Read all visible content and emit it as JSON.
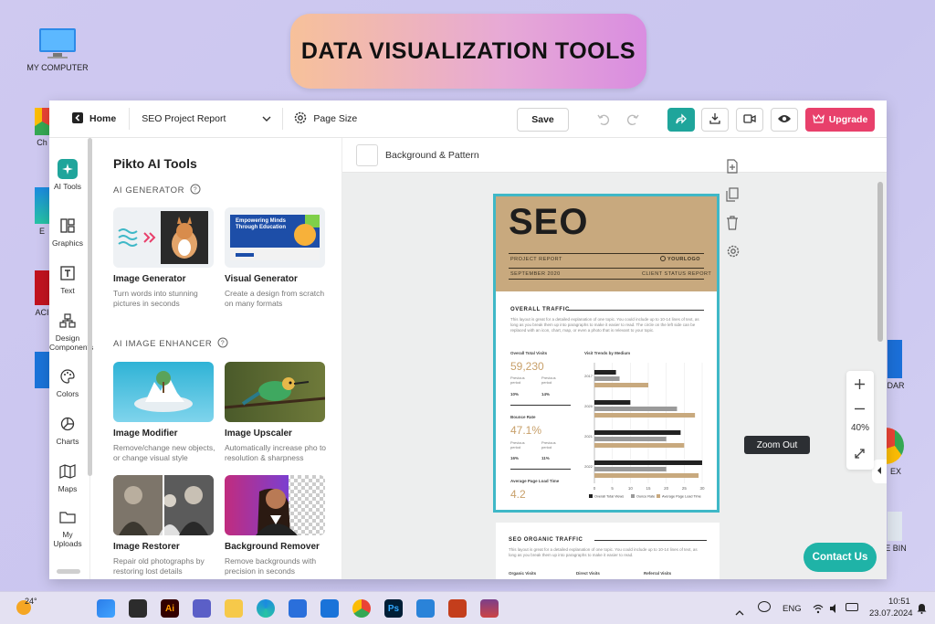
{
  "banner": {
    "title": "DATA VISUALIZATION TOOLS"
  },
  "desktop": {
    "icons": [
      {
        "label": "MY COMPUTER"
      },
      {
        "label": "Ch"
      },
      {
        "label": "E"
      },
      {
        "label": "ACI"
      },
      {
        "label": "DAR"
      },
      {
        "label": "EX"
      },
      {
        "label": "E BIN"
      }
    ]
  },
  "topbar": {
    "home_label": "Home",
    "project_name": "SEO Project Report",
    "page_size_label": "Page Size",
    "save_label": "Save",
    "upgrade_label": "Upgrade"
  },
  "rail": {
    "items": [
      {
        "label": "AI Tools"
      },
      {
        "label": "Graphics"
      },
      {
        "label": "Text"
      },
      {
        "label": "Design Components"
      },
      {
        "label": "Colors"
      },
      {
        "label": "Charts"
      },
      {
        "label": "Maps"
      },
      {
        "label": "My Uploads"
      }
    ]
  },
  "panel": {
    "title": "Pikto AI Tools",
    "section_generator": "AI GENERATOR",
    "section_enhancer": "AI IMAGE ENHANCER",
    "tools": [
      {
        "title": "Image Generator",
        "desc": "Turn words into stunning pictures in seconds"
      },
      {
        "title": "Visual Generator",
        "desc": "Create a design from scratch on many formats"
      },
      {
        "title": "Image Modifier",
        "desc": "Remove/change new objects, or change visual style"
      },
      {
        "title": "Image Upscaler",
        "desc": "Automatically increase pho to resolution & sharpness"
      },
      {
        "title": "Image Restorer",
        "desc": "Repair old photographs by restoring lost details"
      },
      {
        "title": "Background Remover",
        "desc": "Remove backgrounds with precision in seconds"
      }
    ],
    "visual_gen_thumb_text": "Empowering Minds Through Education"
  },
  "canvas": {
    "background_label": "Background & Pattern",
    "zoom_level": "40%",
    "zoom_tooltip": "Zoom Out",
    "contact_label": "Contact Us"
  },
  "doc": {
    "title": "SEO",
    "project_report": "PROJECT REPORT",
    "logo": "YOURLOGO",
    "date": "SEPTEMBER 2020",
    "client": "CLIENT STATUS REPORT",
    "overall_heading": "OVERALL TRAFFIC",
    "overall_text": "This layout is great for a detailed explanation of one topic. You could include up to 10-14 lines of text, as long as you break them up into paragraphs to make it easier to read. The circle on the left side can be replaced with an icon, chart, map, or even a photo that is relevant to your topic.",
    "total_visits_label": "Overall Total Visits",
    "total_visits_value": "59,230",
    "bounce_label": "Bounce Rate",
    "bounce_value": "47.1%",
    "load_label": "Average Page Load Time",
    "load_value": "4.2",
    "prev_label": "Previous period",
    "prev_a1": "10%",
    "prev_a2": "14%",
    "prev_b1": "16%",
    "prev_b2": "11%",
    "chart_title": "Visit Trends by Medium",
    "organic_heading": "SEO ORGANIC TRAFFIC",
    "organic_text": "This layout is great for a detailed explanation of one topic. You could include up to 10-14 lines of text, as long as you break them up into paragraphs to make it easier to read.",
    "organic_cols": [
      "Organic Visits",
      "Direct Visits",
      "Referral Visits"
    ]
  },
  "chart_data": {
    "type": "bar",
    "orientation": "horizontal",
    "title": "Visit Trends by Medium",
    "categories": [
      "2017",
      "2020",
      "2021",
      "2022"
    ],
    "series": [
      {
        "name": "Overall Total Views",
        "color": "#222222",
        "values": [
          6,
          10,
          24,
          30
        ]
      },
      {
        "name": "Ounce Rate",
        "color": "#9a9a9a",
        "values": [
          7,
          23,
          20,
          20
        ]
      },
      {
        "name": "Average Page Load Time",
        "color": "#c8a97e",
        "values": [
          15,
          28,
          25,
          29
        ]
      }
    ],
    "xlim": [
      0,
      30
    ],
    "xticks": [
      "0",
      "5",
      "10",
      "15",
      "20",
      "25",
      "30"
    ]
  },
  "taskbar": {
    "weather": "24°",
    "language": "ENG",
    "time": "10:51",
    "date": "23.07.2024"
  },
  "colors": {
    "accent": "#1fb3a7",
    "upgrade": "#e8406b",
    "selection": "#3fb8c7"
  }
}
